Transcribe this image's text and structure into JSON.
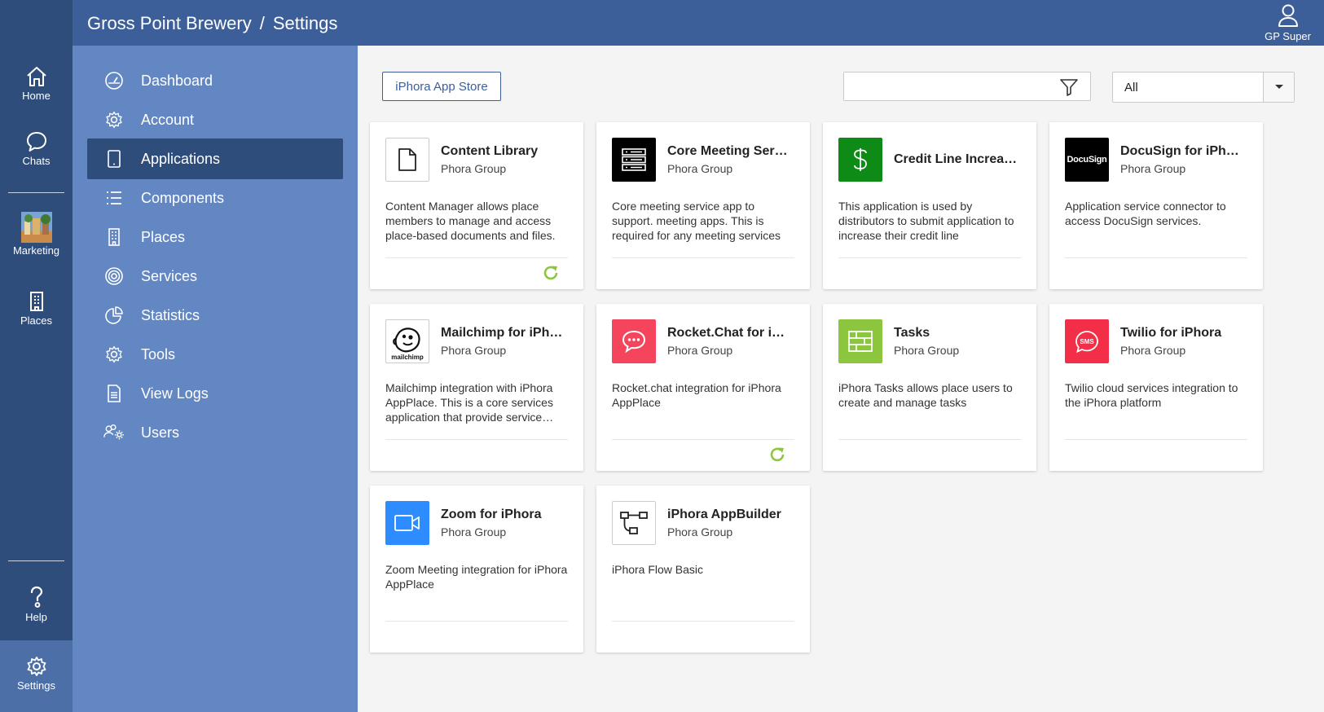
{
  "header": {
    "org": "Gross Point Brewery",
    "separator": "/",
    "page": "Settings",
    "user": "GP Super"
  },
  "rail": {
    "home": "Home",
    "chats": "Chats",
    "marketing": "Marketing",
    "places": "Places",
    "help": "Help",
    "settings": "Settings"
  },
  "nav": {
    "items": [
      {
        "label": "Dashboard",
        "icon": "gauge-icon"
      },
      {
        "label": "Account",
        "icon": "gear-icon"
      },
      {
        "label": "Applications",
        "icon": "tablet-icon"
      },
      {
        "label": "Components",
        "icon": "list-icon"
      },
      {
        "label": "Places",
        "icon": "building-icon"
      },
      {
        "label": "Services",
        "icon": "target-icon"
      },
      {
        "label": "Statistics",
        "icon": "pie-chart-icon"
      },
      {
        "label": "Tools",
        "icon": "gear-icon"
      },
      {
        "label": "View Logs",
        "icon": "document-icon"
      },
      {
        "label": "Users",
        "icon": "users-gear-icon"
      }
    ],
    "active": "Applications"
  },
  "toolbar": {
    "store_label": "iPhora App Store",
    "search_value": "",
    "select_value": "All"
  },
  "cards": [
    {
      "title": "Content Library",
      "sub": "Phora Group",
      "desc": "Content Manager allows place members to manage and access place-based documents and files.",
      "logo": "document-icon",
      "refresh": true
    },
    {
      "title": "Core Meeting Ser…",
      "sub": "Phora Group",
      "desc": "Core meeting service app to support. meeting apps. This is required for any meeting services",
      "logo": "server-icon",
      "refresh": false
    },
    {
      "title": "Credit Line Increa…",
      "sub": "",
      "desc": "This application is used by distributors to submit application to increase their credit line",
      "logo": "dollar-icon",
      "refresh": false
    },
    {
      "title": "DocuSign for iPh…",
      "sub": "Phora Group",
      "desc": "Application service connector to access DocuSign services.",
      "logo": "docusign-logo",
      "logo_text": "DocuSign",
      "refresh": false
    },
    {
      "title": "Mailchimp for iPh…",
      "sub": "Phora Group",
      "desc": "Mailchimp integration with iPhora AppPlace. This is a core services application that provide service…",
      "logo": "mailchimp-logo",
      "logo_text": "mailchimp",
      "refresh": false
    },
    {
      "title": "Rocket.Chat for i…",
      "sub": "Phora Group",
      "desc": "Rocket.chat integration for iPhora AppPlace",
      "logo": "chat-bubble-icon",
      "refresh": true
    },
    {
      "title": "Tasks",
      "sub": "Phora Group",
      "desc": "iPhora Tasks allows place users to create and manage tasks",
      "logo": "table-icon",
      "refresh": false
    },
    {
      "title": "Twilio for iPhora",
      "sub": "Phora Group",
      "desc": "Twilio cloud services integration to the iPhora platform",
      "logo": "sms-icon",
      "logo_text": "SMS",
      "refresh": false
    },
    {
      "title": "Zoom for iPhora",
      "sub": "Phora Group",
      "desc": "Zoom Meeting integration for iPhora AppPlace",
      "logo": "video-camera-icon",
      "refresh": false
    },
    {
      "title": "iPhora AppBuilder",
      "sub": "Phora Group",
      "desc": "iPhora Flow Basic",
      "logo": "flow-icon",
      "refresh": false
    }
  ],
  "colors": {
    "rail": "#2f4d7a",
    "header": "#3d5f99",
    "nav": "#6287c2",
    "nav_active": "#2f4d7a",
    "refresh": "#8cc63f"
  }
}
